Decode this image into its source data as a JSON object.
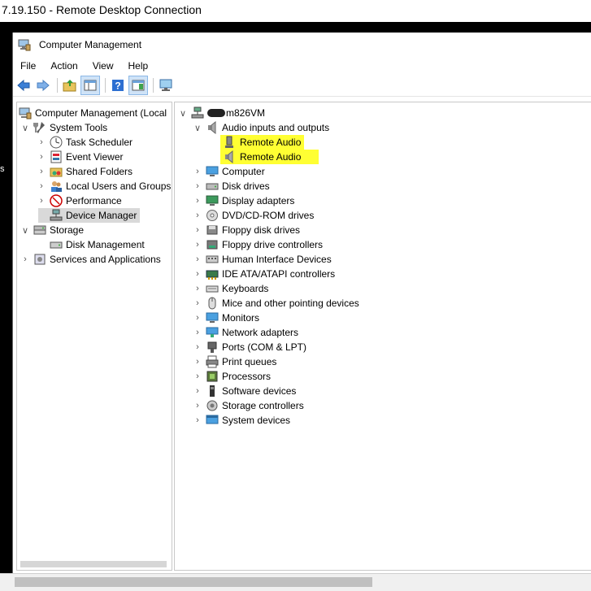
{
  "rdp": {
    "title": "7.19.150 - Remote Desktop Connection",
    "edge_text": "s"
  },
  "window": {
    "title": "Computer Management"
  },
  "menu": [
    "File",
    "Action",
    "View",
    "Help"
  ],
  "toolbar": [
    "back-icon",
    "forward-icon",
    "up-folder-icon",
    "show-hide-tree-icon",
    "help-icon",
    "properties-icon",
    "monitor-icon"
  ],
  "tree": {
    "root": "Computer Management (Local",
    "system_tools": "System Tools",
    "task_scheduler": "Task Scheduler",
    "event_viewer": "Event Viewer",
    "shared_folders": "Shared Folders",
    "local_users": "Local Users and Groups",
    "performance": "Performance",
    "device_manager": "Device Manager",
    "storage": "Storage",
    "disk_management": "Disk Management",
    "services": "Services and Applications"
  },
  "devices": {
    "computer_name": "m826VM",
    "audio": "Audio inputs and outputs",
    "remote_audio_1": "Remote Audio",
    "remote_audio_2": "Remote Audio",
    "categories": [
      "Computer",
      "Disk drives",
      "Display adapters",
      "DVD/CD-ROM drives",
      "Floppy disk drives",
      "Floppy drive controllers",
      "Human Interface Devices",
      "IDE ATA/ATAPI controllers",
      "Keyboards",
      "Mice and other pointing devices",
      "Monitors",
      "Network adapters",
      "Ports (COM & LPT)",
      "Print queues",
      "Processors",
      "Software devices",
      "Storage controllers",
      "System devices"
    ]
  },
  "colors": {
    "highlight": "#ffff33",
    "selection": "#d9d9d9",
    "accent": "#1e6fcf"
  }
}
